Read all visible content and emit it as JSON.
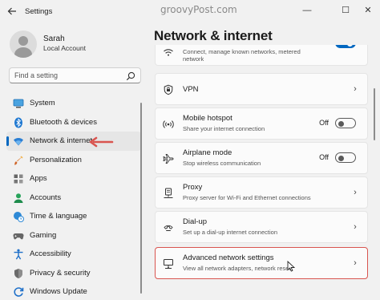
{
  "window": {
    "title": "Settings",
    "watermark": "groovyPost.com",
    "controls": {
      "minimize": "—",
      "maximize": "☐",
      "close": "✕"
    }
  },
  "user": {
    "name": "Sarah",
    "account": "Local Account"
  },
  "search": {
    "placeholder": "Find a setting"
  },
  "sidebar": {
    "items": [
      {
        "label": "System",
        "icon": "system-icon"
      },
      {
        "label": "Bluetooth & devices",
        "icon": "bluetooth-icon"
      },
      {
        "label": "Network & internet",
        "icon": "wifi-icon",
        "active": true
      },
      {
        "label": "Personalization",
        "icon": "brush-icon"
      },
      {
        "label": "Apps",
        "icon": "apps-icon"
      },
      {
        "label": "Accounts",
        "icon": "person-icon"
      },
      {
        "label": "Time & language",
        "icon": "globe-clock-icon"
      },
      {
        "label": "Gaming",
        "icon": "gamepad-icon"
      },
      {
        "label": "Accessibility",
        "icon": "accessibility-icon"
      },
      {
        "label": "Privacy & security",
        "icon": "shield-icon"
      },
      {
        "label": "Windows Update",
        "icon": "update-icon"
      }
    ]
  },
  "main": {
    "title": "Network & internet",
    "cards": [
      {
        "title": "",
        "subtitle": "Connect, manage known networks, metered\nnetwork",
        "icon": "wifi-icon",
        "control": "toggle",
        "toggle_label": "On",
        "toggle_on": true
      },
      {
        "title": "VPN",
        "subtitle": "",
        "icon": "vpn-shield-icon",
        "control": "chevron"
      },
      {
        "title": "Mobile hotspot",
        "subtitle": "Share your internet connection",
        "icon": "hotspot-icon",
        "control": "toggle",
        "toggle_label": "Off",
        "toggle_on": false
      },
      {
        "title": "Airplane mode",
        "subtitle": "Stop wireless communication",
        "icon": "airplane-icon",
        "control": "toggle",
        "toggle_label": "Off",
        "toggle_on": false
      },
      {
        "title": "Proxy",
        "subtitle": "Proxy server for Wi-Fi and Ethernet connections",
        "icon": "proxy-icon",
        "control": "chevron"
      },
      {
        "title": "Dial-up",
        "subtitle": "Set up a dial-up internet connection",
        "icon": "dialup-icon",
        "control": "chevron"
      },
      {
        "title": "Advanced network settings",
        "subtitle": "View all network adapters, network reset",
        "icon": "pc-network-icon",
        "control": "chevron",
        "highlighted": true
      }
    ],
    "chevron": "›"
  },
  "colors": {
    "accent": "#0067c0",
    "annotation": "#d9544f"
  }
}
